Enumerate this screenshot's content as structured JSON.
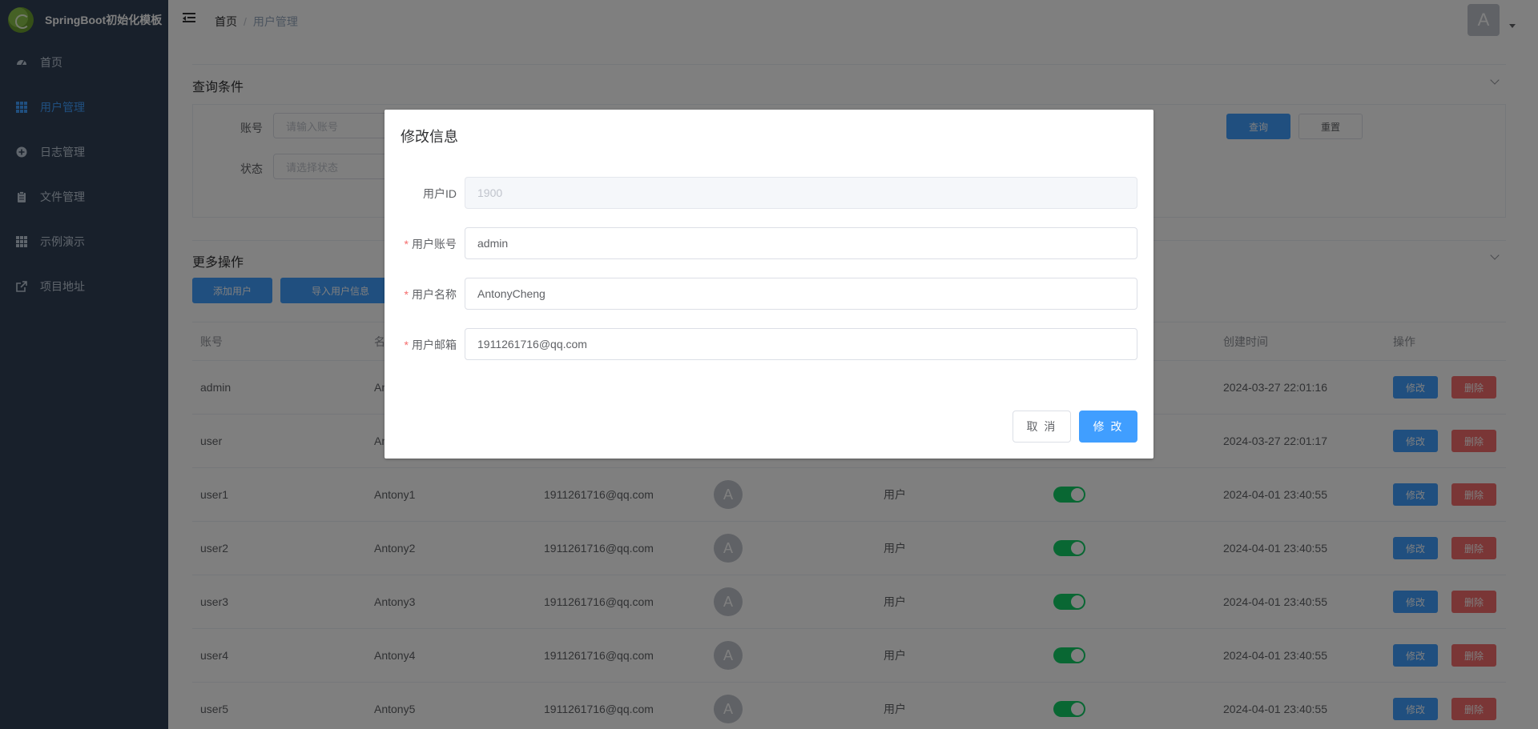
{
  "app": {
    "title": "SpringBoot初始化模板",
    "logo_icon": "spring-leaf-icon"
  },
  "sidebar": {
    "items": [
      {
        "label": "首页",
        "icon": "dashboard-icon",
        "active": false
      },
      {
        "label": "用户管理",
        "icon": "grid-icon",
        "active": true
      },
      {
        "label": "日志管理",
        "icon": "plus-circle-icon",
        "active": false
      },
      {
        "label": "文件管理",
        "icon": "clipboard-icon",
        "active": false
      },
      {
        "label": "示例演示",
        "icon": "grid-icon",
        "active": false
      },
      {
        "label": "项目地址",
        "icon": "external-link-icon",
        "active": false
      }
    ]
  },
  "header": {
    "breadcrumb": [
      "首页",
      "用户管理"
    ],
    "breadcrumb_sep": "/",
    "avatar_letter": "A"
  },
  "query": {
    "title": "查询条件",
    "account_label": "账号",
    "account_placeholder": "请输入账号",
    "status_label": "状态",
    "status_placeholder": "请选择状态",
    "search_button": "查询",
    "reset_button": "重置"
  },
  "more_ops": {
    "title": "更多操作",
    "add_user_button": "添加用户",
    "import_button": "导入用户信息"
  },
  "table": {
    "headers": {
      "account": "账号",
      "name": "名",
      "time": "创建时间",
      "ops": "操作"
    },
    "edit_label": "修改",
    "delete_label": "删除",
    "rows": [
      {
        "account": "admin",
        "name": "An",
        "email": "",
        "avatar": "",
        "role": "",
        "time": "2024-03-27 22:01:16"
      },
      {
        "account": "user",
        "name": "An",
        "email": "",
        "avatar": "",
        "role": "",
        "time": "2024-03-27 22:01:17"
      },
      {
        "account": "user1",
        "name": "Antony1",
        "email": "1911261716@qq.com",
        "avatar": "A",
        "role": "用户",
        "time": "2024-04-01 23:40:55"
      },
      {
        "account": "user2",
        "name": "Antony2",
        "email": "1911261716@qq.com",
        "avatar": "A",
        "role": "用户",
        "time": "2024-04-01 23:40:55"
      },
      {
        "account": "user3",
        "name": "Antony3",
        "email": "1911261716@qq.com",
        "avatar": "A",
        "role": "用户",
        "time": "2024-04-01 23:40:55"
      },
      {
        "account": "user4",
        "name": "Antony4",
        "email": "1911261716@qq.com",
        "avatar": "A",
        "role": "用户",
        "time": "2024-04-01 23:40:55"
      },
      {
        "account": "user5",
        "name": "Antony5",
        "email": "1911261716@qq.com",
        "avatar": "A",
        "role": "用户",
        "time": "2024-04-01 23:40:55"
      }
    ]
  },
  "dialog": {
    "title": "修改信息",
    "fields": {
      "user_id_label": "用户ID",
      "user_id_value": "1900",
      "account_label": "用户账号",
      "account_value": "admin",
      "name_label": "用户名称",
      "name_value": "AntonyCheng",
      "email_label": "用户邮箱",
      "email_value": "1911261716@qq.com",
      "required_mark": "*"
    },
    "cancel_button": "取 消",
    "submit_button": "修 改"
  },
  "colors": {
    "sidebar_bg": "#304156",
    "primary": "#409eff",
    "danger": "#f56c6c",
    "switch_on": "#13ce66"
  }
}
